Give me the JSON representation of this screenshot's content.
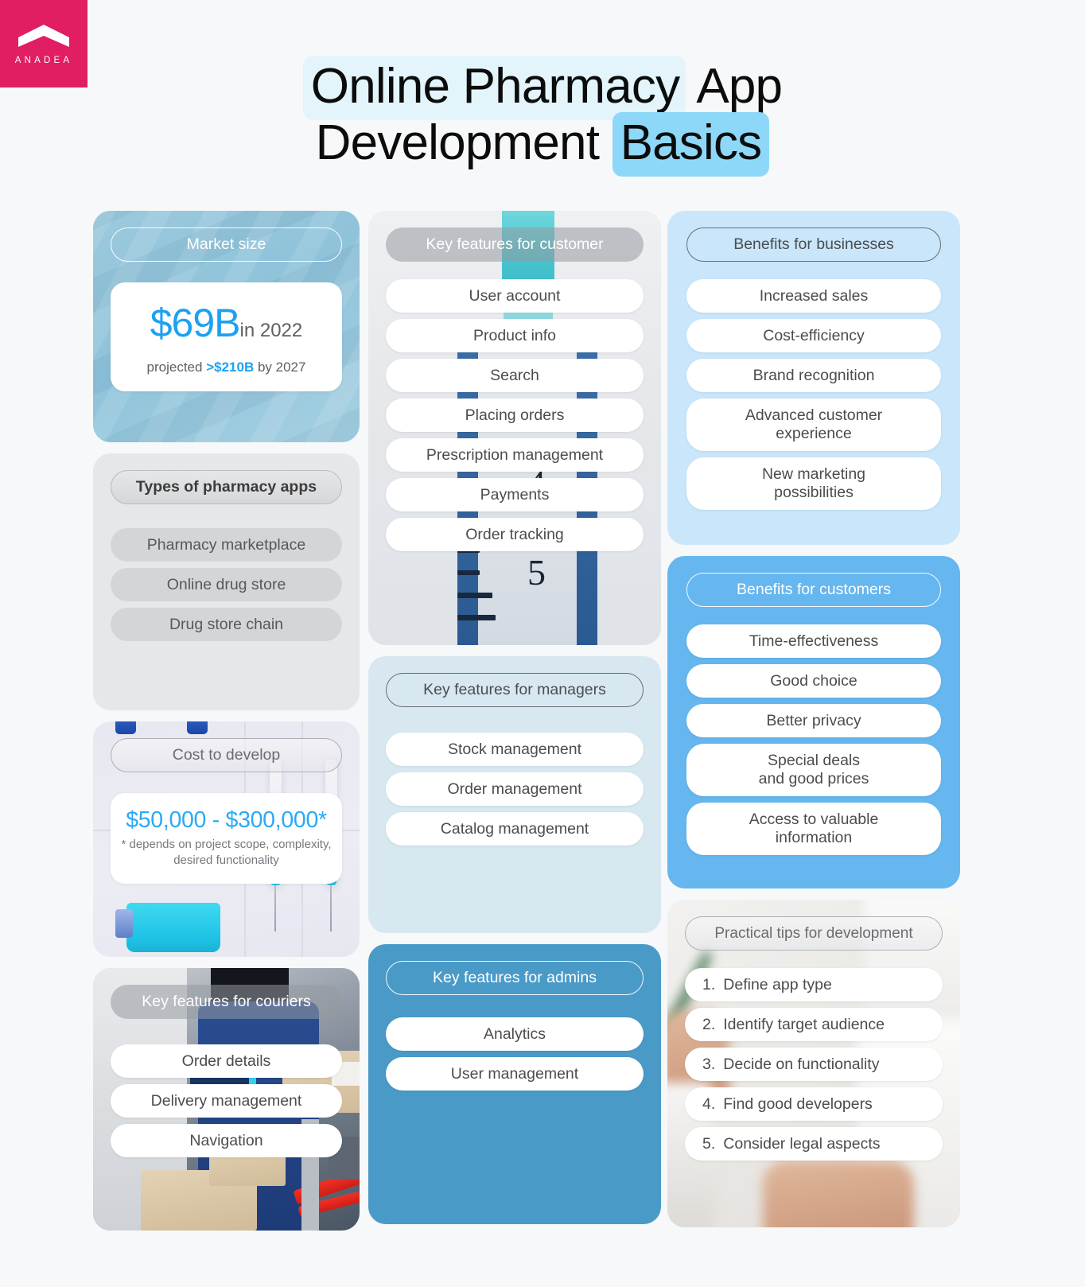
{
  "brand": {
    "name": "ANADEA",
    "color": "#e11d63",
    "logo_icon": "chevron-mark"
  },
  "title": {
    "line1_plain": "Online Pharmacy",
    "line1_tail": " App",
    "line2_plain": "Development ",
    "line2_highlight": "Basics"
  },
  "colors": {
    "accent_blue": "#1da1f2",
    "brand_pink": "#e11d63",
    "highlight_blue": "#8dd8f8",
    "page_bg": "#f7f8f9"
  },
  "cards": {
    "market_size": {
      "header": "Market size",
      "figure": "$69B",
      "figure_suffix": "in 2022",
      "projection_prefix": "projected ",
      "projection_value": ">$210B",
      "projection_suffix": " by 2027"
    },
    "types_of_apps": {
      "header": "Types of pharmacy apps",
      "items": [
        "Pharmacy marketplace",
        "Online drug store",
        "Drug store chain"
      ]
    },
    "cost_to_develop": {
      "header": "Cost to develop",
      "figure": "$50,000 - $300,000*",
      "note_line1": "* depends on project scope, complexity,",
      "note_line2": "desired functionality"
    },
    "features_couriers": {
      "header": "Key features for couriers",
      "items": [
        "Order details",
        "Delivery management",
        "Navigation"
      ]
    },
    "features_customer": {
      "header": "Key features for customer",
      "items": [
        "User account",
        "Product info",
        "Search",
        "Placing orders",
        "Prescription management",
        "Payments",
        "Order tracking"
      ],
      "ruler_marks": [
        "4",
        "5"
      ]
    },
    "features_managers": {
      "header": "Key features for managers",
      "items": [
        "Stock management",
        "Order management",
        "Catalog management"
      ]
    },
    "features_admins": {
      "header": "Key features for admins",
      "items": [
        "Analytics",
        "User management"
      ]
    },
    "benefits_businesses": {
      "header": "Benefits for businesses",
      "items": [
        "Increased sales",
        "Cost-efficiency",
        "Brand recognition",
        "Advanced customer\nexperience",
        "New marketing\npossibilities"
      ]
    },
    "benefits_customers": {
      "header": "Benefits for customers",
      "items": [
        "Time-effectiveness",
        "Good choice",
        "Better privacy",
        "Special deals\nand good prices",
        "Access to valuable\ninformation"
      ]
    },
    "practical_tips": {
      "header": "Practical tips for development",
      "items": [
        {
          "num": "1.",
          "text": "Define app type"
        },
        {
          "num": "2.",
          "text": "Identify target audience"
        },
        {
          "num": "3.",
          "text": "Decide on functionality"
        },
        {
          "num": "4.",
          "text": "Find good developers"
        },
        {
          "num": "5.",
          "text": "Consider legal aspects"
        }
      ]
    }
  }
}
